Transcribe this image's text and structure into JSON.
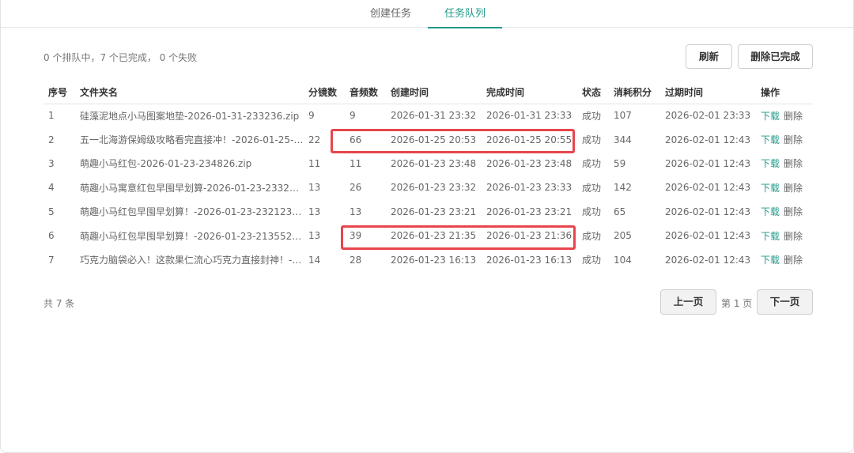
{
  "tabs": [
    {
      "label": "创建任务"
    },
    {
      "label": "任务队列"
    }
  ],
  "summary": "0 个排队中，7 个已完成， 0 个失败",
  "buttons": {
    "refresh": "刷新",
    "clear_done": "删除已完成"
  },
  "table": {
    "headers": [
      "序号",
      "文件夹名",
      "分镜数",
      "音频数",
      "创建时间",
      "完成时间",
      "状态",
      "消耗积分",
      "过期时间",
      "操作"
    ],
    "rows": [
      {
        "idx": "1",
        "name": "硅藻泥地点小马图案地垫-2026-01-31-233236.zip",
        "shots": "9",
        "audio": "9",
        "created": "2026-01-31 23:32",
        "finished": "2026-01-31 23:33",
        "status": "成功",
        "cost": "107",
        "expire": "2026-02-01 23:33"
      },
      {
        "idx": "2",
        "name": "五一北海游保姆级攻略看完直接冲！-2026-01-25-…",
        "shots": "22",
        "audio": "66",
        "created": "2026-01-25 20:53",
        "finished": "2026-01-25 20:55",
        "status": "成功",
        "cost": "344",
        "expire": "2026-02-01 12:43"
      },
      {
        "idx": "3",
        "name": "萌趣小马红包-2026-01-23-234826.zip",
        "shots": "11",
        "audio": "11",
        "created": "2026-01-23 23:48",
        "finished": "2026-01-23 23:48",
        "status": "成功",
        "cost": "59",
        "expire": "2026-02-01 12:43"
      },
      {
        "idx": "4",
        "name": "萌趣小马寓意红包早囤早划算-2026-01-23-23322…",
        "shots": "13",
        "audio": "26",
        "created": "2026-01-23 23:32",
        "finished": "2026-01-23 23:33",
        "status": "成功",
        "cost": "142",
        "expire": "2026-02-01 12:43"
      },
      {
        "idx": "5",
        "name": "萌趣小马红包早囤早划算！-2026-01-23-232123.…",
        "shots": "13",
        "audio": "13",
        "created": "2026-01-23 23:21",
        "finished": "2026-01-23 23:21",
        "status": "成功",
        "cost": "65",
        "expire": "2026-02-01 12:43"
      },
      {
        "idx": "6",
        "name": "萌趣小马红包早囤早划算！-2026-01-23-213552.…",
        "shots": "13",
        "audio": "39",
        "created": "2026-01-23 21:35",
        "finished": "2026-01-23 21:36",
        "status": "成功",
        "cost": "205",
        "expire": "2026-02-01 12:43"
      },
      {
        "idx": "7",
        "name": "巧克力脑袋必入！这款果仁流心巧克力直接封神！-…",
        "shots": "14",
        "audio": "28",
        "created": "2026-01-23 16:13",
        "finished": "2026-01-23 16:13",
        "status": "成功",
        "cost": "104",
        "expire": "2026-02-01 12:43"
      }
    ],
    "actions": {
      "download": "下载",
      "delete": "删除"
    }
  },
  "pagination": {
    "total": "共 7 条",
    "prev": "上一页",
    "page": "第 1 页",
    "next": "下一页"
  },
  "colors": {
    "accent": "#1f9a8a",
    "highlight": "#e8454d"
  }
}
